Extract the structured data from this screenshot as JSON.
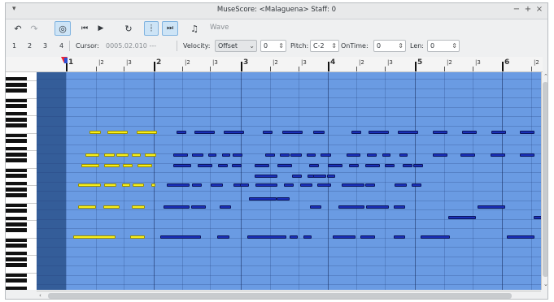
{
  "window": {
    "title": "MuseScore: <Malaguena> Staff: 0",
    "menu_glyph": "▾",
    "controls": {
      "minimize": "−",
      "maximize": "+",
      "close": "×"
    }
  },
  "toolbar": {
    "undo_icon": "↶",
    "redo_icon": "↷",
    "select_tool_icon": "◎",
    "rewind_icon": "⏮",
    "play_icon": "▶",
    "loop_icon": "↻",
    "loop_in_icon": "⦙",
    "loop_out_icon": "⏭",
    "metronome_icon": "♫",
    "wave_label": "Wave"
  },
  "controls": {
    "voices": [
      "1",
      "2",
      "3",
      "4"
    ],
    "cursor_label": "Cursor:",
    "cursor_value": "0005.02.010 ---",
    "velocity_label": "Velocity:",
    "velocity_mode": "Offset",
    "velocity_value": "0",
    "pitch_label": "Pitch:",
    "pitch_value": "C-2",
    "ontime_label": "OnTime:",
    "ontime_value": "0",
    "len_label": "Len:",
    "len_value": "0"
  },
  "ruler": {
    "labels": [
      "1",
      "|2",
      "|3",
      "2",
      "|2",
      "|3",
      "3",
      "|2",
      "|3",
      "4",
      "|2",
      "|3",
      "5",
      "|2",
      "|3",
      "6",
      "|2"
    ]
  },
  "colors": {
    "grid_bg": "#6a9be3",
    "selected_note": "#f7ef1c",
    "unselected_note": "#1a2fb8",
    "selected_tool": "#cde4f6"
  }
}
